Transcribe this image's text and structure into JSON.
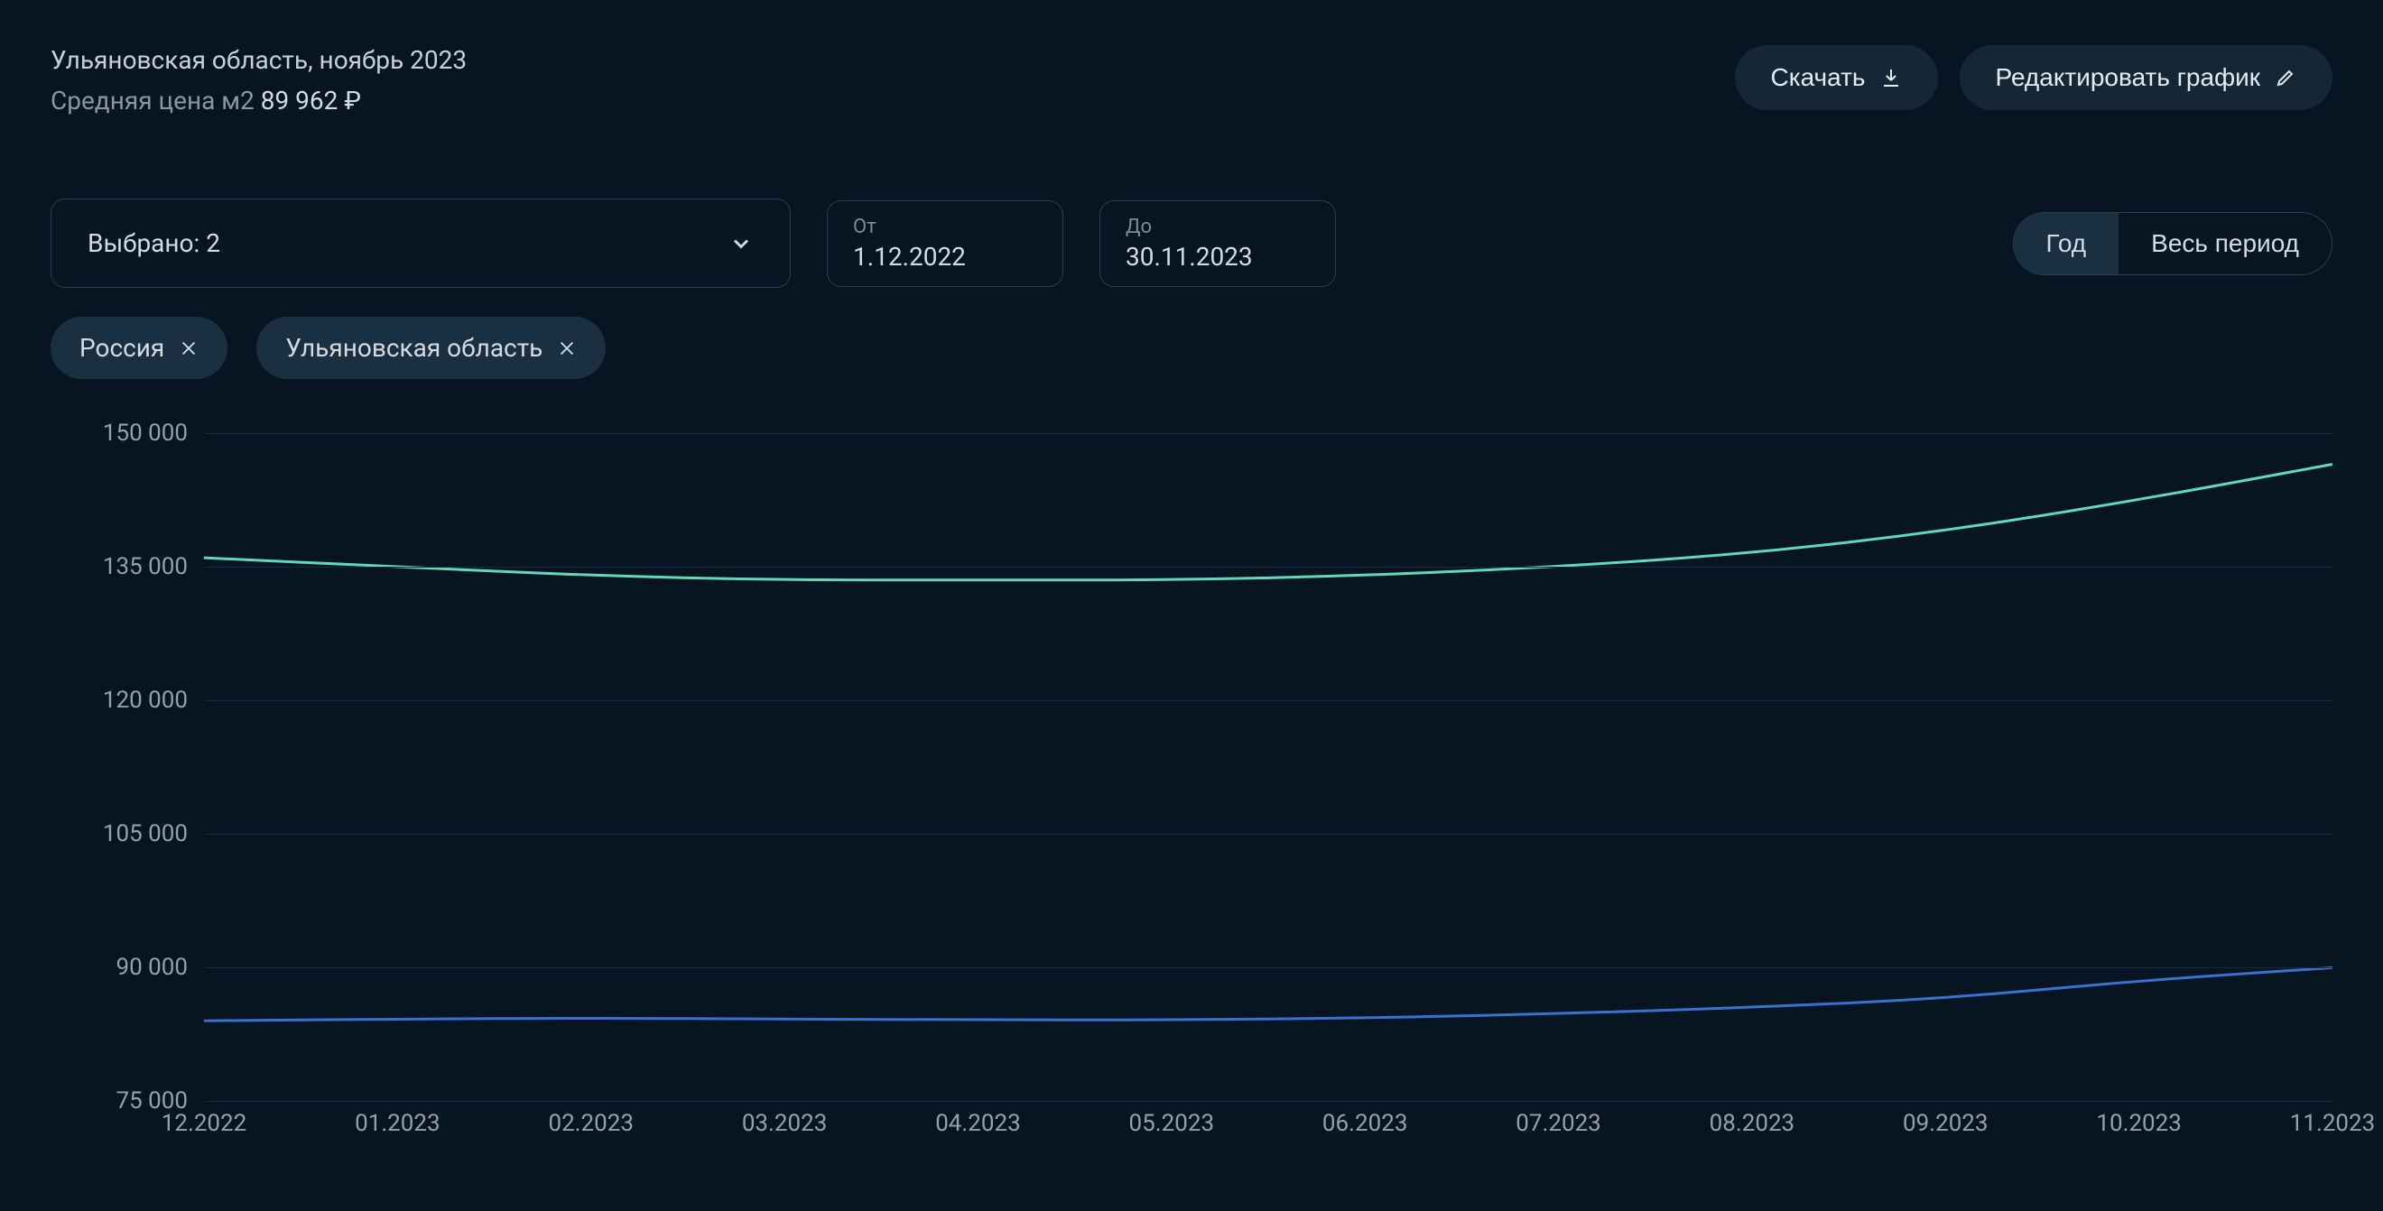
{
  "header": {
    "title": "Ульяновская область, ноябрь 2023",
    "subtitle_label": "Средняя цена м2",
    "subtitle_value": "89 962 ₽"
  },
  "actions": {
    "download": "Скачать",
    "edit": "Редактировать график"
  },
  "controls": {
    "select_label": "Выбрано: 2",
    "date_from_label": "От",
    "date_from_value": "1.12.2022",
    "date_to_label": "До",
    "date_to_value": "30.11.2023",
    "toggle_year": "Год",
    "toggle_all": "Весь период"
  },
  "chips": [
    {
      "label": "Россия"
    },
    {
      "label": "Ульяновская область"
    }
  ],
  "chart_data": {
    "type": "line",
    "title": "",
    "xlabel": "",
    "ylabel": "",
    "ylim": [
      75000,
      150000
    ],
    "categories": [
      "12.2022",
      "01.2023",
      "02.2023",
      "03.2023",
      "04.2023",
      "05.2023",
      "06.2023",
      "07.2023",
      "08.2023",
      "09.2023",
      "10.2023",
      "11.2023"
    ],
    "y_ticks": [
      75000,
      90000,
      105000,
      120000,
      135000,
      150000
    ],
    "y_tick_labels": [
      "75 000",
      "90 000",
      "105 000",
      "120 000",
      "135 000",
      "150 000"
    ],
    "series": [
      {
        "name": "Россия",
        "color": "#5fd9b8",
        "values": [
          136000,
          135000,
          134000,
          133500,
          133500,
          133500,
          134000,
          135000,
          136500,
          139000,
          142500,
          146500
        ]
      },
      {
        "name": "Ульяновская область",
        "color": "#3d6fd1",
        "values": [
          84000,
          84200,
          84300,
          84200,
          84100,
          84100,
          84300,
          84800,
          85500,
          86500,
          88500,
          89962
        ]
      }
    ]
  }
}
